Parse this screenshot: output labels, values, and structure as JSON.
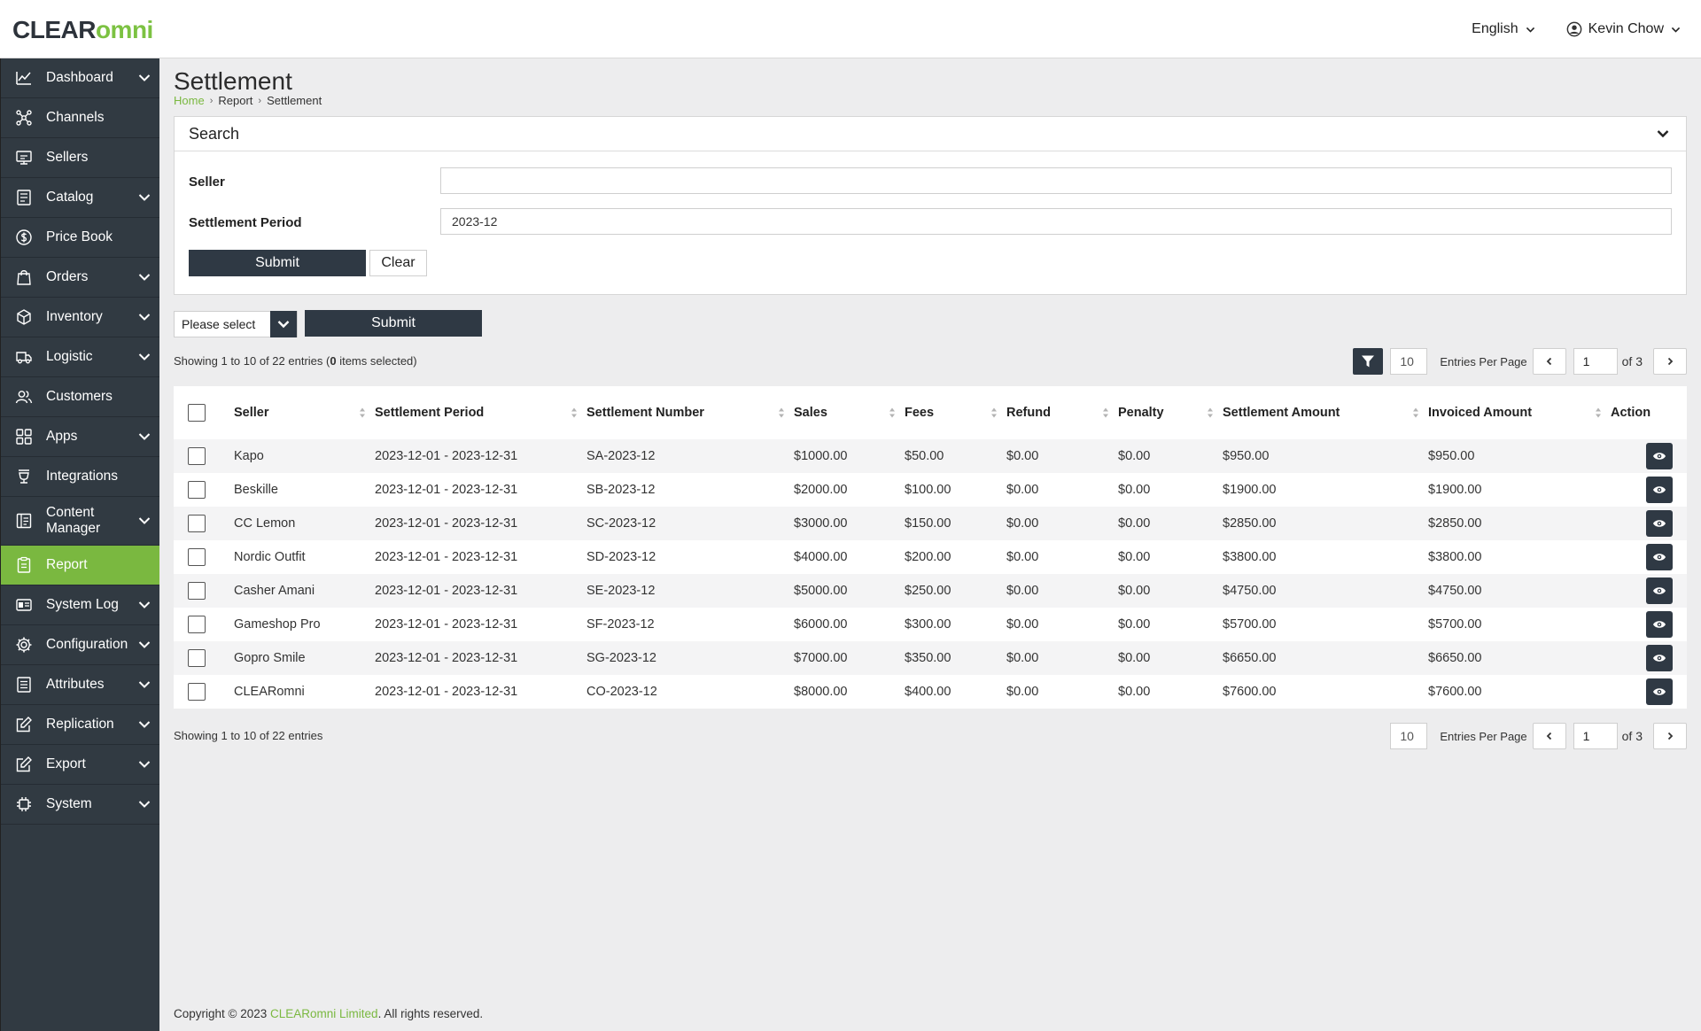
{
  "header": {
    "logo_clear": "CLEAR",
    "logo_omni": "omni",
    "language": "English",
    "user": "Kevin Chow"
  },
  "sidebar": {
    "items": [
      {
        "label": "Dashboard",
        "icon": "chart-line-icon",
        "has_children": true
      },
      {
        "label": "Channels",
        "icon": "network-icon",
        "has_children": false
      },
      {
        "label": "Sellers",
        "icon": "seller-icon",
        "has_children": false
      },
      {
        "label": "Catalog",
        "icon": "catalog-icon",
        "has_children": true
      },
      {
        "label": "Price Book",
        "icon": "dollar-icon",
        "has_children": false
      },
      {
        "label": "Orders",
        "icon": "shopping-bag-icon",
        "has_children": true
      },
      {
        "label": "Inventory",
        "icon": "box-icon",
        "has_children": true
      },
      {
        "label": "Logistic",
        "icon": "truck-icon",
        "has_children": true
      },
      {
        "label": "Customers",
        "icon": "users-icon",
        "has_children": false
      },
      {
        "label": "Apps",
        "icon": "apps-grid-icon",
        "has_children": true
      },
      {
        "label": "Integrations",
        "icon": "plug-icon",
        "has_children": false
      },
      {
        "label": "Content Manager",
        "icon": "content-icon",
        "has_children": true
      },
      {
        "label": "Report",
        "icon": "report-icon",
        "has_children": false,
        "active": true
      },
      {
        "label": "System Log",
        "icon": "log-icon",
        "has_children": true
      },
      {
        "label": "Configuration",
        "icon": "gear-icon",
        "has_children": true
      },
      {
        "label": "Attributes",
        "icon": "list-icon",
        "has_children": true
      },
      {
        "label": "Replication",
        "icon": "edit-icon",
        "has_children": true
      },
      {
        "label": "Export",
        "icon": "export-icon",
        "has_children": true
      },
      {
        "label": "System",
        "icon": "chip-icon",
        "has_children": true
      }
    ],
    "active_color": "#7ab840"
  },
  "page": {
    "title": "Settlement",
    "breadcrumb": [
      "Home",
      "Report",
      "Settlement"
    ]
  },
  "search": {
    "title": "Search",
    "seller_label": "Seller",
    "seller_value": "",
    "period_label": "Settlement Period",
    "period_value": "2023-12",
    "submit": "Submit",
    "clear": "Clear"
  },
  "bulk": {
    "select_value": "Please select",
    "submit": "Submit"
  },
  "listing": {
    "showing_prefix": "Showing 1 to 10 of 22 entries (",
    "selected_count": "0",
    "showing_suffix": " items selected)",
    "showing_bottom": "Showing 1 to 10 of 22 entries",
    "per_page": "10",
    "per_page_label": "Entries Per Page",
    "page": "1",
    "of_pages": "of 3"
  },
  "table": {
    "columns": [
      "Seller",
      "Settlement Period",
      "Settlement Number",
      "Sales",
      "Fees",
      "Refund",
      "Penalty",
      "Settlement Amount",
      "Invoiced Amount",
      "Action"
    ],
    "rows": [
      [
        "Kapo",
        "2023-12-01 - 2023-12-31",
        "SA-2023-12",
        "$1000.00",
        "$50.00",
        "$0.00",
        "$0.00",
        "$950.00",
        "$950.00"
      ],
      [
        "Beskille",
        "2023-12-01 - 2023-12-31",
        "SB-2023-12",
        "$2000.00",
        "$100.00",
        "$0.00",
        "$0.00",
        "$1900.00",
        "$1900.00"
      ],
      [
        "CC Lemon",
        "2023-12-01 - 2023-12-31",
        "SC-2023-12",
        "$3000.00",
        "$150.00",
        "$0.00",
        "$0.00",
        "$2850.00",
        "$2850.00"
      ],
      [
        "Nordic Outfit",
        "2023-12-01 - 2023-12-31",
        "SD-2023-12",
        "$4000.00",
        "$200.00",
        "$0.00",
        "$0.00",
        "$3800.00",
        "$3800.00"
      ],
      [
        "Casher Amani",
        "2023-12-01 - 2023-12-31",
        "SE-2023-12",
        "$5000.00",
        "$250.00",
        "$0.00",
        "$0.00",
        "$4750.00",
        "$4750.00"
      ],
      [
        "Gameshop Pro",
        "2023-12-01 - 2023-12-31",
        "SF-2023-12",
        "$6000.00",
        "$300.00",
        "$0.00",
        "$0.00",
        "$5700.00",
        "$5700.00"
      ],
      [
        "Gopro Smile",
        "2023-12-01 - 2023-12-31",
        "SG-2023-12",
        "$7000.00",
        "$350.00",
        "$0.00",
        "$0.00",
        "$6650.00",
        "$6650.00"
      ],
      [
        "CLEARomni",
        "2023-12-01 - 2023-12-31",
        "CO-2023-12",
        "$8000.00",
        "$400.00",
        "$0.00",
        "$0.00",
        "$7600.00",
        "$7600.00"
      ]
    ]
  },
  "footer": {
    "prefix": "Copyright © 2023 ",
    "link": "CLEARomni Limited",
    "suffix": ". All rights reserved."
  }
}
